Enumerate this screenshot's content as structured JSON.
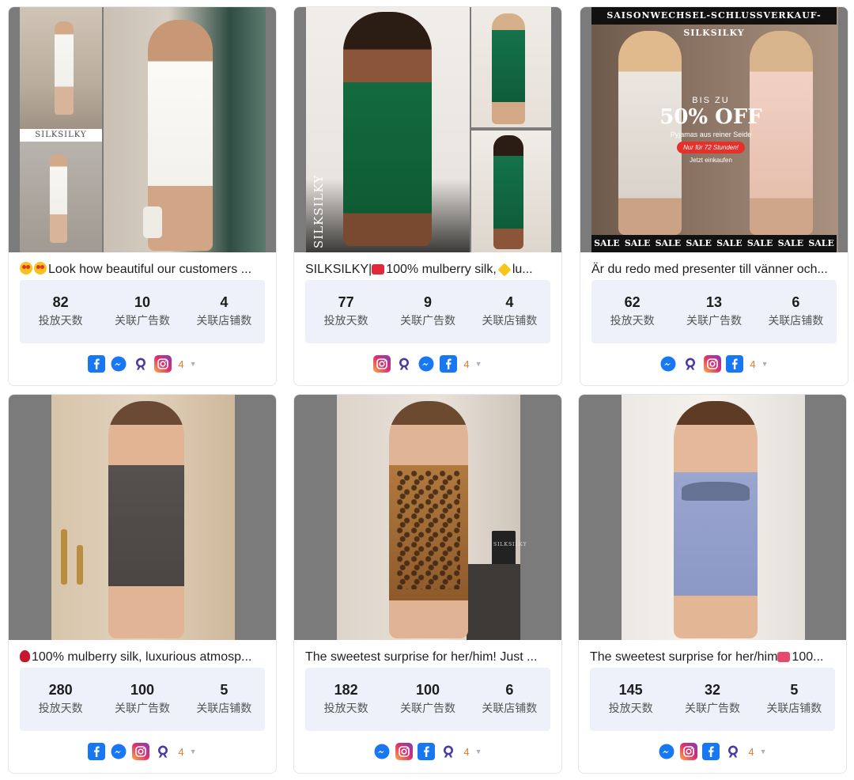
{
  "cards": [
    {
      "title": "Look how beautiful our customers ...",
      "title_prefix_emoji": [
        "star-struck-emoji",
        "star-struck-emoji"
      ],
      "image_label": "SILKSILKY",
      "stats": [
        {
          "value": "82",
          "label": "投放天数"
        },
        {
          "value": "10",
          "label": "关联广告数"
        },
        {
          "value": "4",
          "label": "关联店铺数"
        }
      ],
      "platforms": [
        "facebook-icon",
        "messenger-icon",
        "audience-network-icon",
        "instagram-icon"
      ],
      "platform_count": "4"
    },
    {
      "title": "SILKSILKY|  100% mulberry silk,  lu...",
      "title_text_a": "SILKSILKY|",
      "title_text_b": "100% mulberry silk,",
      "title_text_c": "lu...",
      "image_label": "SILKSILKY",
      "stats": [
        {
          "value": "77",
          "label": "投放天数"
        },
        {
          "value": "9",
          "label": "关联广告数"
        },
        {
          "value": "4",
          "label": "关联店铺数"
        }
      ],
      "platforms": [
        "instagram-icon",
        "audience-network-icon",
        "messenger-icon",
        "facebook-icon"
      ],
      "platform_count": "4"
    },
    {
      "title": "Är du redo med presenter till vänner och...",
      "banner_top": "SAISONWECHSEL-SCHLUSSVERKAUF-SILKSILKY",
      "promo_upto": "BIS ZU",
      "promo_off": "50% OFF",
      "promo_sub": "Pyjamas aus reiner Seide",
      "promo_pill": "Nur für 72 Stunden!",
      "promo_cta": "Jetzt einkaufen",
      "banner_bottom": [
        "SALE",
        "SALE",
        "SALE",
        "SALE",
        "SALE",
        "SALE",
        "SALE",
        "SALE"
      ],
      "stats": [
        {
          "value": "62",
          "label": "投放天数"
        },
        {
          "value": "13",
          "label": "关联广告数"
        },
        {
          "value": "6",
          "label": "关联店铺数"
        }
      ],
      "platforms": [
        "messenger-icon",
        "audience-network-icon",
        "instagram-icon",
        "facebook-icon"
      ],
      "platform_count": "4"
    },
    {
      "title": "100% mulberry silk, luxurious atmosp...",
      "stats": [
        {
          "value": "280",
          "label": "投放天数"
        },
        {
          "value": "100",
          "label": "关联广告数"
        },
        {
          "value": "5",
          "label": "关联店铺数"
        }
      ],
      "platforms": [
        "facebook-icon",
        "messenger-icon",
        "instagram-icon",
        "audience-network-icon"
      ],
      "platform_count": "4"
    },
    {
      "title": "The sweetest surprise for her/him! Just ...",
      "image_label": "SILKSILKY",
      "stats": [
        {
          "value": "182",
          "label": "投放天数"
        },
        {
          "value": "100",
          "label": "关联广告数"
        },
        {
          "value": "6",
          "label": "关联店铺数"
        }
      ],
      "platforms": [
        "messenger-icon",
        "instagram-icon",
        "facebook-icon",
        "audience-network-icon"
      ],
      "platform_count": "4"
    },
    {
      "title": "The sweetest surprise for her/him  100...",
      "title_text_a": "The sweetest surprise for her/him",
      "title_text_b": "100...",
      "stats": [
        {
          "value": "145",
          "label": "投放天数"
        },
        {
          "value": "32",
          "label": "关联广告数"
        },
        {
          "value": "5",
          "label": "关联店铺数"
        }
      ],
      "platforms": [
        "messenger-icon",
        "instagram-icon",
        "facebook-icon",
        "audience-network-icon"
      ],
      "platform_count": "4"
    }
  ],
  "colors": {
    "facebook": "#1877f2",
    "messenger": "#1877f2",
    "instagram": "#d6287a",
    "audience_network": "#4a3aa6",
    "count": "#e37d2d",
    "stats_bg": "#eef1f9"
  }
}
